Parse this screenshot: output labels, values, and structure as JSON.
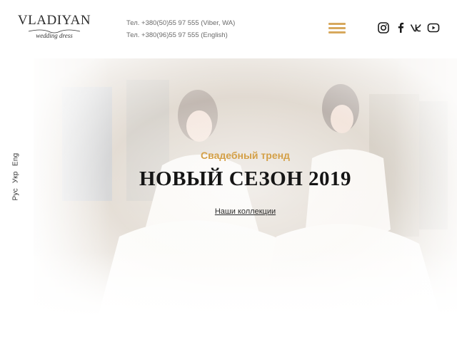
{
  "header": {
    "logo_text": "VLADIYAN",
    "logo_subtitle": "wedding dress",
    "phones": [
      "Тел. +380(50)55 97 555 (Viber, WA)",
      "Тел. +380(96)55 97 555 (English)"
    ],
    "menu_icon": "hamburger-menu-icon",
    "menu_color": "#d7a85d",
    "socials": [
      "instagram-icon",
      "facebook-icon",
      "vk-icon",
      "youtube-icon"
    ]
  },
  "languages": [
    "Рус",
    "Укр",
    "Eng"
  ],
  "hero": {
    "subtitle": "Свадебный тренд",
    "title": "НОВЫЙ СЕЗОН 2019",
    "link": "Наши коллекции",
    "accent_color": "#d4a048"
  }
}
